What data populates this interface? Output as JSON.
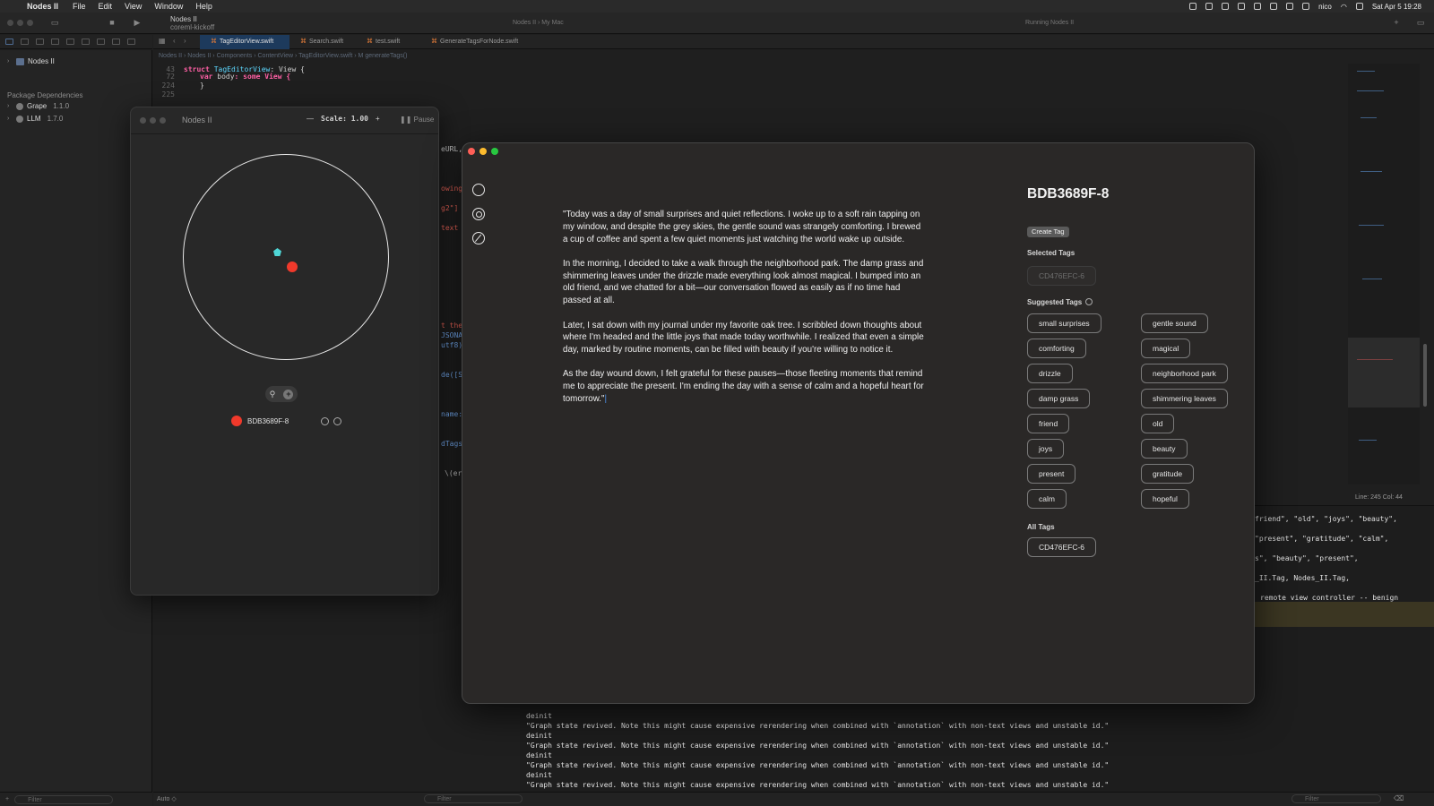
{
  "menubar": {
    "app_name": "Nodes II",
    "items": [
      "File",
      "Edit",
      "View",
      "Window",
      "Help"
    ],
    "user": "nico",
    "datetime": "Sat Apr 5  19:28"
  },
  "toolbar": {
    "scheme_name": "Nodes II",
    "scheme_branch": "coreml-kickoff",
    "destination": "Nodes II  ›  My Mac",
    "run_status": "Running Nodes II"
  },
  "navigator": {
    "project": "Nodes II",
    "deps_header": "Package Dependencies",
    "packages": [
      {
        "name": "Grape",
        "version": "1.1.0"
      },
      {
        "name": "LLM",
        "version": "1.7.0"
      }
    ],
    "filter_placeholder": "Filter"
  },
  "editor": {
    "tabs": [
      "TagEditorView.swift",
      "Search.swift",
      "test.swift",
      "GenerateTagsForNode.swift"
    ],
    "breadcrumb": "Nodes II  ›  Nodes II  ›  Components  ›  ContentView  ›  TagEditorView.swift  ›  M  generateTags()",
    "lines": [
      {
        "num": "43",
        "kw": "struct",
        "rest_type": "TagEditorView",
        "rest": ": View {"
      },
      {
        "num": "72",
        "kw": "var",
        "rest_type": "body",
        "rest": ": some View {"
      },
      {
        "num": "224",
        "kw": "",
        "rest_type": "",
        "rest": "}"
      },
      {
        "num": "225",
        "kw": "",
        "rest_type": "",
        "rest": ""
      }
    ],
    "fragments": [
      "eURL,",
      "owing",
      "g2\"]",
      "text",
      "t the",
      "JSONA",
      "utf8)",
      "de([S",
      "name:",
      "dTags",
      "\\(er"
    ],
    "status": "Line: 245  Col: 44"
  },
  "console": {
    "right_lines": [
      "friend\", \"old\", \"joys\", \"beauty\",",
      "\"present\", \"gratitude\", \"calm\",",
      "s\", \"beauty\", \"present\",",
      "_II.Tag, Nodes_II.Tag,",
      "remote view controller -- benign"
    ],
    "log_message": "\"Graph state revived. Note this might cause expensive rerendering when combined with `annotation` with non-text views and unstable id.\"",
    "deinit": "deinit",
    "filter_placeholder": "Filter",
    "auto_label": "Auto ◇"
  },
  "node_window": {
    "title": "Nodes II",
    "scale_label": "Scale: 1.00",
    "pause_label": "Pause",
    "node_label": "BDB3689F-8"
  },
  "tag_editor": {
    "node_id": "BDB3689F-8",
    "create_tag_label": "Create Tag",
    "selected_header": "Selected Tags",
    "selected_tags": [
      "CD476EFC-6"
    ],
    "suggested_header": "Suggested Tags",
    "suggested_tags_left": [
      "small surprises",
      "comforting",
      "drizzle",
      "damp grass",
      "friend",
      "joys",
      "present",
      "calm"
    ],
    "suggested_tags_right": [
      "gentle sound",
      "magical",
      "neighborhood park",
      "shimmering leaves",
      "old",
      "beauty",
      "gratitude",
      "hopeful"
    ],
    "all_header": "All Tags",
    "all_tags": [
      "CD476EFC-6"
    ],
    "paragraphs": [
      "\"Today was a day of small surprises and quiet reflections. I woke up to a soft rain tapping on my window, and despite the grey skies, the gentle sound was strangely comforting. I brewed a cup of coffee and spent a few quiet moments just watching the world wake up outside.",
      "In the morning, I decided to take a walk through the neighborhood park. The damp grass and shimmering leaves under the drizzle made everything look almost magical. I bumped into an old friend, and we chatted for a bit—our conversation flowed as easily as if no time had passed at all.",
      "Later, I sat down with my journal under my favorite oak tree. I scribbled down thoughts about where I'm headed and the little joys that made today worthwhile. I realized that even a simple day, marked by routine moments, can be filled with beauty if you're willing to notice it.",
      "As the day wound down, I felt grateful for these pauses—those fleeting moments that remind me to appreciate the present. I'm ending the day with a sense of calm and a hopeful heart for tomorrow.\""
    ]
  },
  "colors": {
    "accent_blue": "#1d3a5c",
    "node_red": "#f0392b",
    "node_teal": "#4fd6d6",
    "close": "#ff5f57",
    "minimize": "#febc2e",
    "zoom": "#28c840"
  }
}
